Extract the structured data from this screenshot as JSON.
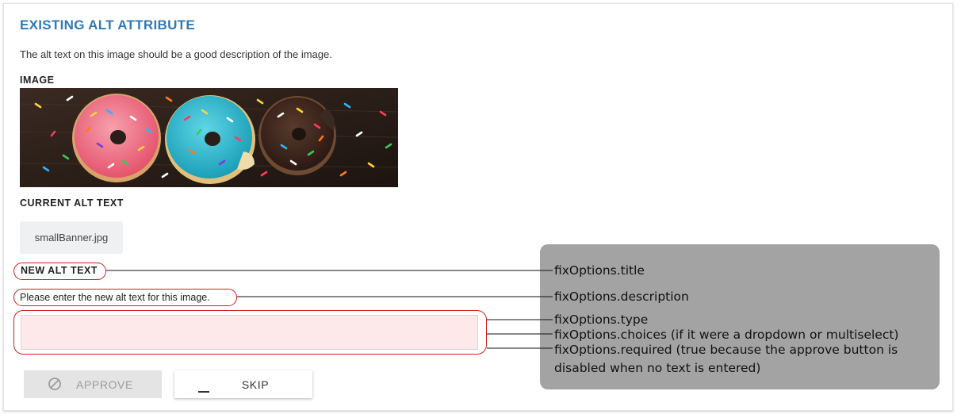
{
  "section": {
    "title": "EXISTING ALT ATTRIBUTE",
    "description": "The alt text on this image should be a good description of the image."
  },
  "image_label": "IMAGE",
  "image_alt_scene": "donut-banner",
  "current_alt": {
    "label": "CURRENT ALT TEXT",
    "value": "smallBanner.jpg"
  },
  "new_alt": {
    "label": "NEW ALT TEXT",
    "help": "Please enter the new alt text for this image.",
    "value": "",
    "placeholder": ""
  },
  "buttons": {
    "approve": {
      "label": "APPROVE",
      "icon": "circle-slash-icon",
      "disabled": true
    },
    "skip": {
      "label": "SKIP",
      "icon": "minus-icon"
    }
  },
  "annotations": {
    "title": "fixOptions.title",
    "description": "fixOptions.description",
    "type": "fixOptions.type",
    "choices": "fixOptions.choices (if it were a dropdown or multiselect)",
    "required_line1": "fixOptions.required (true because the approve button is",
    "required_line2": "disabled when no text is entered)"
  },
  "colors": {
    "title": "#2f7ab7",
    "highlight_ring": "#d21f1f",
    "input_error_bg": "#fde9e9",
    "annotation_box": "#a3a3a3"
  }
}
